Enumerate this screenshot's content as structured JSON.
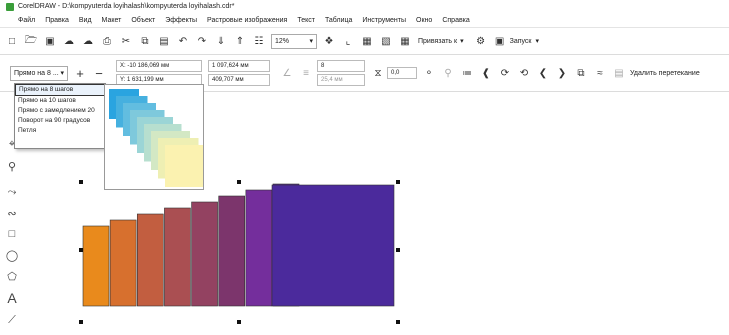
{
  "title": "CorelDRAW - D:\\kompyuterda loyihalash\\kompyuterda loyihalash.cdr*",
  "menu": [
    "Файл",
    "Правка",
    "Вид",
    "Макет",
    "Объект",
    "Эффекты",
    "Растровые изображения",
    "Текст",
    "Таблица",
    "Инструменты",
    "Окно",
    "Справка"
  ],
  "toolbar": {
    "zoom": "12%",
    "snap_label": "Привязать к",
    "launch_label": "Запуск"
  },
  "propbar": {
    "preset": "Прямо на 8 ...",
    "x": "X: -10 186,069 мм",
    "y": "Y: 1 631,199 мм",
    "width": "1 097,624 мм",
    "height": "409,707 мм",
    "steps": "8",
    "offset": "25,4 мм",
    "angle": "0,0",
    "delete_label": "Удалить перетекание"
  },
  "dropdown_options": [
    "Прямо на 8 шагов",
    "Прямо на 10 шагов",
    "Прямо с замедлением 20",
    "Поворот на 90 градусов",
    "Петля"
  ],
  "blend_colors": [
    "#e98a1c",
    "#d7702e",
    "#c25e40",
    "#aa4f52",
    "#934261",
    "#7c356c",
    "#742e9c",
    "#5c2aa8",
    "#4b2a9c"
  ],
  "preview_colors": [
    "#2aa4e0",
    "#46b0df",
    "#62bde0",
    "#7ec9dc",
    "#9bd5d6",
    "#b7dfcf",
    "#d3e8c4",
    "#eeefb3",
    "#fbf2b0"
  ]
}
